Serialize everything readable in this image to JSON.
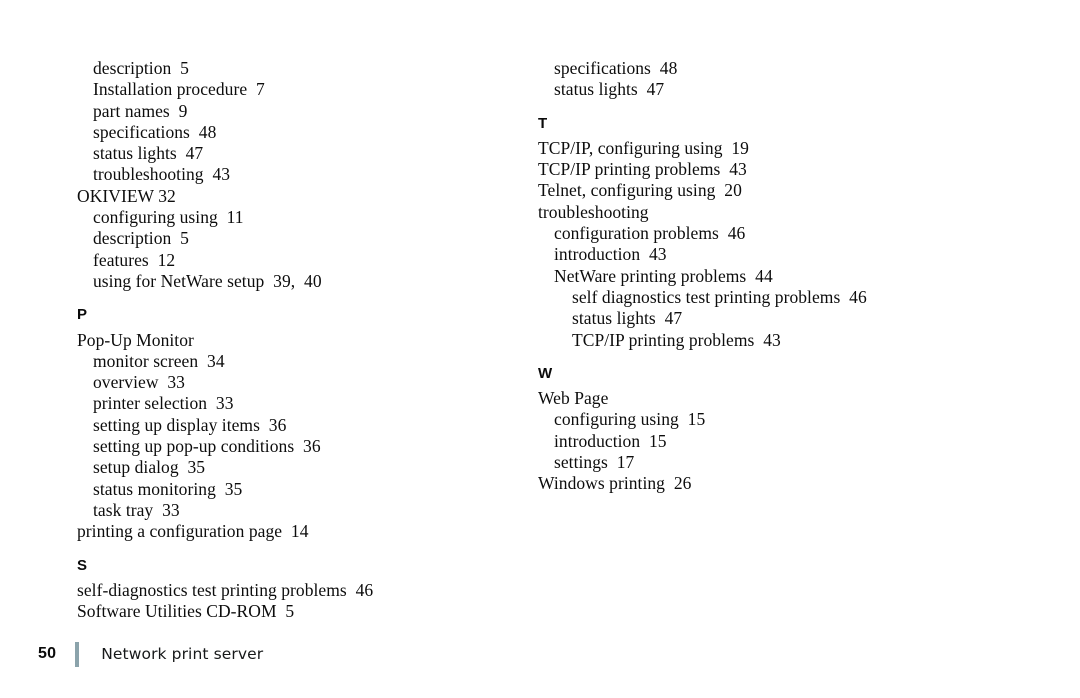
{
  "document": {
    "page_number": "50",
    "footer_title": "Network print server",
    "rule_color": "#8ba3ab"
  },
  "columns": {
    "left": [
      {
        "type": "entry",
        "level": 2,
        "text": "description  5"
      },
      {
        "type": "entry",
        "level": 2,
        "text": "Installation procedure  7"
      },
      {
        "type": "entry",
        "level": 2,
        "text": "part names  9"
      },
      {
        "type": "entry",
        "level": 2,
        "text": "specifications  48"
      },
      {
        "type": "entry",
        "level": 2,
        "text": "status lights  47"
      },
      {
        "type": "entry",
        "level": 2,
        "text": "troubleshooting  43"
      },
      {
        "type": "entry",
        "level": 1,
        "text": "OKIVIEW 32"
      },
      {
        "type": "entry",
        "level": 2,
        "text": "configuring using  11"
      },
      {
        "type": "entry",
        "level": 2,
        "text": "description  5"
      },
      {
        "type": "entry",
        "level": 2,
        "text": "features  12"
      },
      {
        "type": "entry",
        "level": 2,
        "text": "using for NetWare setup  39,  40"
      },
      {
        "type": "heading",
        "text": "P"
      },
      {
        "type": "entry",
        "level": 1,
        "text": "Pop-Up Monitor"
      },
      {
        "type": "entry",
        "level": 2,
        "text": "monitor screen  34"
      },
      {
        "type": "entry",
        "level": 2,
        "text": "overview  33"
      },
      {
        "type": "entry",
        "level": 2,
        "text": "printer selection  33"
      },
      {
        "type": "entry",
        "level": 2,
        "text": "setting up display items  36"
      },
      {
        "type": "entry",
        "level": 2,
        "text": "setting up pop-up conditions  36"
      },
      {
        "type": "entry",
        "level": 2,
        "text": "setup dialog  35"
      },
      {
        "type": "entry",
        "level": 2,
        "text": "status monitoring  35"
      },
      {
        "type": "entry",
        "level": 2,
        "text": "task tray  33"
      },
      {
        "type": "entry",
        "level": 1,
        "text": "printing a configuration page  14"
      },
      {
        "type": "heading",
        "text": "S"
      },
      {
        "type": "entry",
        "level": 1,
        "text": "self-diagnostics test printing problems  46"
      },
      {
        "type": "entry",
        "level": 1,
        "text": "Software Utilities CD-ROM  5"
      }
    ],
    "right": [
      {
        "type": "entry",
        "level": 2,
        "text": "specifications  48"
      },
      {
        "type": "entry",
        "level": 2,
        "text": "status lights  47"
      },
      {
        "type": "heading",
        "text": "T"
      },
      {
        "type": "entry",
        "level": 1,
        "text": "TCP/IP, configuring using  19"
      },
      {
        "type": "entry",
        "level": 1,
        "text": "TCP/IP printing problems  43"
      },
      {
        "type": "entry",
        "level": 1,
        "text": "Telnet, configuring using  20"
      },
      {
        "type": "entry",
        "level": 1,
        "text": "troubleshooting"
      },
      {
        "type": "entry",
        "level": 2,
        "text": "configuration problems  46"
      },
      {
        "type": "entry",
        "level": 2,
        "text": "introduction  43"
      },
      {
        "type": "entry",
        "level": 2,
        "text": "NetWare printing problems  44"
      },
      {
        "type": "entry",
        "level": 3,
        "text": "self diagnostics test printing problems  46"
      },
      {
        "type": "entry",
        "level": 3,
        "text": "status lights  47"
      },
      {
        "type": "entry",
        "level": 3,
        "text": "TCP/IP printing problems  43"
      },
      {
        "type": "heading",
        "text": "W"
      },
      {
        "type": "entry",
        "level": 1,
        "text": "Web Page"
      },
      {
        "type": "entry",
        "level": 2,
        "text": "configuring using  15"
      },
      {
        "type": "entry",
        "level": 2,
        "text": "introduction  15"
      },
      {
        "type": "entry",
        "level": 2,
        "text": "settings  17"
      },
      {
        "type": "entry",
        "level": 1,
        "text": "Windows printing  26"
      }
    ]
  }
}
